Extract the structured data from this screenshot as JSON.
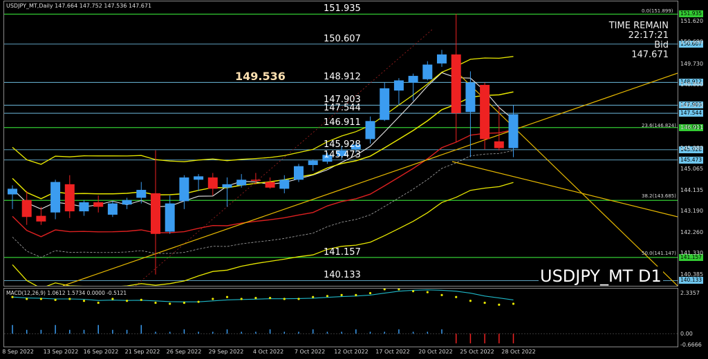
{
  "header": {
    "title": "USDJPY_MT,Daily",
    "ohlc": "147.664 147.752 147.536 147.671"
  },
  "countdown": {
    "label": "TIME REMAIN",
    "time": "22:17:21",
    "bid_label": "Bid",
    "bid_value": "147.671"
  },
  "watermark": "USDJPY_MT D1",
  "callout": "149.536",
  "macd_label": "MACD(12,26,9) 1.0612 1.5734 0.0000 -0.5121",
  "macd_axis": {
    "top": "2.3357",
    "zero": "0.00",
    "bottom": "-0.6666"
  },
  "levels": [
    {
      "label": "151.935",
      "tag": "151.935"
    },
    {
      "label": "150.607",
      "tag": "150.607"
    },
    {
      "label": "148.912",
      "tag": "148.912"
    },
    {
      "label": "147.903",
      "tag": "147.903"
    },
    {
      "label": "147.544",
      "tag": "147.544"
    },
    {
      "label": "146.911",
      "tag": "146.911"
    },
    {
      "label": "145.928",
      "tag": "145.928"
    },
    {
      "label": "145.473",
      "tag": "145.473"
    },
    {
      "label": "141.157",
      "tag": "141.157"
    },
    {
      "label": "140.133",
      "tag": "140.133"
    }
  ],
  "fib_labels": [
    "0.0(151.899)",
    "23.6(146.824)",
    "38.2(143.685)",
    "50.0(141.147)"
  ],
  "price_axis": [
    "151.620",
    "150.690",
    "149.730",
    "148.800",
    "147.870",
    "146.911",
    "145.980",
    "145.065",
    "144.135",
    "143.190",
    "142.260",
    "141.330",
    "140.385"
  ],
  "date_axis": [
    "8 Sep 2022",
    "13 Sep 2022",
    "16 Sep 2022",
    "21 Sep 2022",
    "26 Sep 2022",
    "29 Sep 2022",
    "4 Oct 2022",
    "7 Oct 2022",
    "12 Oct 2022",
    "17 Oct 2022",
    "20 Oct 2022",
    "25 Oct 2022",
    "28 Oct 2022"
  ],
  "colors": {
    "bull": "#3b9cf0",
    "bear": "#ee2222",
    "level_line": "#7fd7ff",
    "green_line": "#33cc33",
    "bollinger": "#e8e800",
    "ma_red": "#dd2020",
    "ma_white": "#e8e8e8",
    "trend": "#e6b800"
  },
  "chart_data": {
    "type": "candlestick",
    "price_range": [
      139.9,
      152.5
    ],
    "candles": [
      {
        "o": 143.95,
        "h": 144.35,
        "l": 143.3,
        "c": 144.2
      },
      {
        "o": 143.7,
        "h": 144.1,
        "l": 142.6,
        "c": 142.95
      },
      {
        "o": 143.0,
        "h": 143.4,
        "l": 142.6,
        "c": 142.75
      },
      {
        "o": 143.15,
        "h": 144.6,
        "l": 142.85,
        "c": 144.5
      },
      {
        "o": 144.4,
        "h": 144.8,
        "l": 142.9,
        "c": 143.2
      },
      {
        "o": 143.2,
        "h": 143.7,
        "l": 143.0,
        "c": 143.6
      },
      {
        "o": 143.6,
        "h": 143.9,
        "l": 143.15,
        "c": 143.4
      },
      {
        "o": 143.05,
        "h": 143.65,
        "l": 142.95,
        "c": 143.55
      },
      {
        "o": 143.5,
        "h": 143.8,
        "l": 143.3,
        "c": 143.7
      },
      {
        "o": 143.8,
        "h": 144.5,
        "l": 143.55,
        "c": 144.15
      },
      {
        "o": 144.0,
        "h": 145.9,
        "l": 140.4,
        "c": 142.2
      },
      {
        "o": 142.3,
        "h": 143.9,
        "l": 142.2,
        "c": 143.55
      },
      {
        "o": 143.65,
        "h": 144.8,
        "l": 143.3,
        "c": 144.7
      },
      {
        "o": 144.6,
        "h": 144.85,
        "l": 144.1,
        "c": 144.75
      },
      {
        "o": 144.7,
        "h": 144.9,
        "l": 143.9,
        "c": 144.2
      },
      {
        "o": 144.25,
        "h": 144.7,
        "l": 143.4,
        "c": 144.4
      },
      {
        "o": 144.35,
        "h": 144.85,
        "l": 144.25,
        "c": 144.6
      },
      {
        "o": 144.6,
        "h": 144.9,
        "l": 144.4,
        "c": 144.55
      },
      {
        "o": 144.5,
        "h": 144.7,
        "l": 144.2,
        "c": 144.25
      },
      {
        "o": 144.2,
        "h": 144.8,
        "l": 144.0,
        "c": 144.6
      },
      {
        "o": 144.6,
        "h": 145.3,
        "l": 144.5,
        "c": 145.2
      },
      {
        "o": 145.25,
        "h": 145.5,
        "l": 145.0,
        "c": 145.45
      },
      {
        "o": 145.4,
        "h": 145.8,
        "l": 145.3,
        "c": 145.7
      },
      {
        "o": 145.65,
        "h": 146.1,
        "l": 145.5,
        "c": 145.9
      },
      {
        "o": 145.95,
        "h": 146.3,
        "l": 145.8,
        "c": 146.15
      },
      {
        "o": 146.4,
        "h": 147.4,
        "l": 146.2,
        "c": 147.2
      },
      {
        "o": 147.25,
        "h": 148.9,
        "l": 147.2,
        "c": 148.65
      },
      {
        "o": 148.55,
        "h": 149.1,
        "l": 147.9,
        "c": 149.0
      },
      {
        "o": 148.9,
        "h": 149.3,
        "l": 148.1,
        "c": 149.2
      },
      {
        "o": 149.05,
        "h": 149.85,
        "l": 149.0,
        "c": 149.7
      },
      {
        "o": 149.75,
        "h": 150.35,
        "l": 149.6,
        "c": 150.15
      },
      {
        "o": 150.15,
        "h": 151.95,
        "l": 146.25,
        "c": 147.55
      },
      {
        "o": 147.6,
        "h": 149.4,
        "l": 145.6,
        "c": 148.9
      },
      {
        "o": 148.8,
        "h": 148.9,
        "l": 145.95,
        "c": 146.4
      },
      {
        "o": 146.3,
        "h": 147.85,
        "l": 145.9,
        "c": 146.0
      },
      {
        "o": 146.0,
        "h": 147.9,
        "l": 145.6,
        "c": 147.5
      }
    ],
    "macd": [
      1.9,
      1.8,
      1.8,
      1.75,
      1.8,
      1.7,
      1.6,
      1.8,
      1.7,
      1.75,
      1.6,
      1.55,
      1.6,
      1.65,
      1.8,
      1.9,
      1.8,
      1.85,
      1.85,
      1.8,
      1.8,
      1.9,
      1.95,
      2.0,
      2.0,
      2.1,
      2.3,
      2.3,
      2.2,
      2.15,
      2.0,
      1.9,
      1.7,
      1.6,
      1.5,
      1.55
    ],
    "macd_signal": [
      1.9,
      1.85,
      1.83,
      1.8,
      1.8,
      1.78,
      1.72,
      1.74,
      1.72,
      1.73,
      1.7,
      1.66,
      1.65,
      1.65,
      1.7,
      1.75,
      1.77,
      1.79,
      1.81,
      1.81,
      1.82,
      1.84,
      1.88,
      1.92,
      1.95,
      2.0,
      2.1,
      2.2,
      2.25,
      2.27,
      2.25,
      2.2,
      2.1,
      1.95,
      1.85,
      1.75
    ]
  }
}
